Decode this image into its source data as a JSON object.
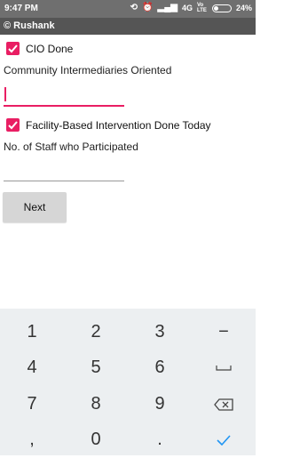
{
  "statusbar": {
    "time": "9:47 PM",
    "network": "4G",
    "volte": "Vo LTE",
    "battery": "24%"
  },
  "appbar": {
    "title": "© Rushank"
  },
  "form": {
    "cio": {
      "label": "CIO Done",
      "checked": true
    },
    "community_label": "Community Intermediaries Oriented",
    "community_value": "",
    "facility": {
      "label": "Facility-Based Intervention Done Today",
      "checked": true
    },
    "staff_label": "No. of Staff who Participated",
    "staff_value": "",
    "next_label": "Next"
  },
  "keyboard": {
    "rows": [
      [
        "1",
        "2",
        "3",
        "−"
      ],
      [
        "4",
        "5",
        "6",
        "space"
      ],
      [
        "7",
        "8",
        "9",
        "backspace"
      ],
      [
        ",",
        "0",
        ".",
        "done"
      ]
    ],
    "accent": "#2196f3"
  },
  "colors": {
    "accent": "#e91e63",
    "statusbar": "#6f6f6f",
    "appbar": "#555555"
  }
}
